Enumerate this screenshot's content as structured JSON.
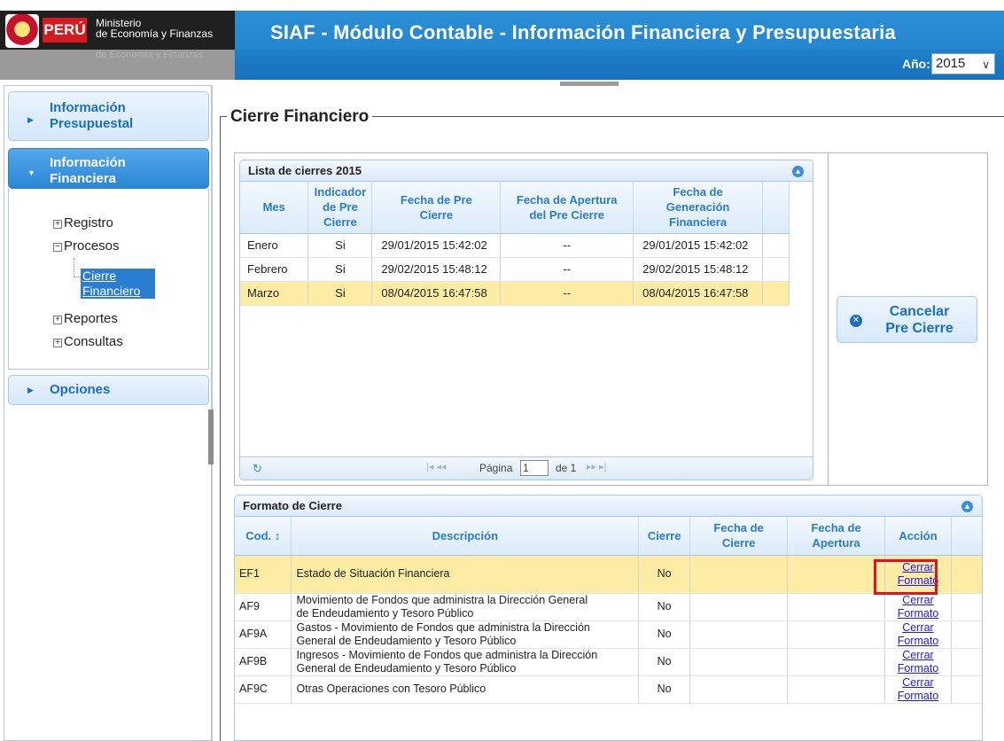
{
  "header": {
    "logo_country": "PERÚ",
    "logo_line1": "Ministerio",
    "logo_line2": "de Economía y Finanzas",
    "logo_reflection": "de Economía y Finanzas",
    "title": "SIAF - Módulo Contable - Información Financiera y Presupuestaria",
    "year_label": "Año:",
    "year_value": "2015"
  },
  "sidebar": {
    "sections": [
      {
        "label_line1": "Información",
        "label_line2": "Presupuestal"
      },
      {
        "label_line1": "Información",
        "label_line2": "Financiera"
      },
      {
        "label_line1": "Opciones",
        "label_line2": ""
      }
    ],
    "tree": {
      "registro": "Registro",
      "procesos": "Procesos",
      "cierre_line1": "Cierre",
      "cierre_line2": "Financiero",
      "reportes": "Reportes",
      "consultas": "Consultas",
      "expanded_symbol": "−",
      "collapsed_symbol": "+"
    }
  },
  "main": {
    "title": "Cierre Financiero",
    "lista": {
      "title": "Lista de cierres 2015",
      "columns": [
        [
          "Mes"
        ],
        [
          "Indicador",
          "de Pre",
          "Cierre"
        ],
        [
          "Fecha de Pre",
          "Cierre"
        ],
        [
          "Fecha de Apertura",
          "del Pre Cierre"
        ],
        [
          "Fecha de",
          "Generación",
          "Financiera"
        ]
      ],
      "rows": [
        {
          "mes": "Enero",
          "indicador": "Si",
          "fecha_pre": "29/01/2015 15:42:02",
          "fecha_apertura": "--",
          "fecha_gen": "29/01/2015 15:42:02"
        },
        {
          "mes": "Febrero",
          "indicador": "Si",
          "fecha_pre": "29/02/2015 15:48:12",
          "fecha_apertura": "--",
          "fecha_gen": "29/02/2015 15:48:12"
        },
        {
          "mes": "Marzo",
          "indicador": "Si",
          "fecha_pre": "08/04/2015 16:47:58",
          "fecha_apertura": "--",
          "fecha_gen": "08/04/2015 16:47:58"
        }
      ],
      "pager": {
        "page_label": "Página",
        "page_value": "1",
        "of_label": "de 1",
        "first_prev": "|◂ ◂◂",
        "next_last": "▸▸ ▸|",
        "refresh": "↻"
      }
    },
    "cancel_button": {
      "line1": "Cancelar",
      "line2": "Pre Cierre"
    },
    "formato": {
      "title": "Formato de Cierre",
      "columns": [
        [
          "Cod. ↕"
        ],
        [
          "Descripción"
        ],
        [
          "Cierre"
        ],
        [
          "Fecha de",
          "Cierre"
        ],
        [
          "Fecha de",
          "Apertura"
        ],
        [
          "Acción"
        ]
      ],
      "rows": [
        {
          "cod": "EF1",
          "desc1": "Estado de Situación Financiera",
          "desc2": "",
          "cierre": "No",
          "fecha_cierre": "",
          "fecha_apertura": "",
          "accion1": "Cerrar",
          "accion2": "Formato"
        },
        {
          "cod": "AF9",
          "desc1": "Movimiento de Fondos que administra la Dirección General",
          "desc2": "de Endeudamiento y Tesoro Público",
          "cierre": "No",
          "fecha_cierre": "",
          "fecha_apertura": "",
          "accion1": "Cerrar",
          "accion2": "Formato"
        },
        {
          "cod": "AF9A",
          "desc1": "Gastos - Movimiento de Fondos que administra la Dirección",
          "desc2": "General de Endeudamiento y Tesoro Público",
          "cierre": "No",
          "fecha_cierre": "",
          "fecha_apertura": "",
          "accion1": "Cerrar",
          "accion2": "Formato"
        },
        {
          "cod": "AF9B",
          "desc1": "Ingresos - Movimiento de Fondos que administra la Dirección",
          "desc2": "General de Endeudamiento y Tesoro Público",
          "cierre": "No",
          "fecha_cierre": "",
          "fecha_apertura": "",
          "accion1": "Cerrar",
          "accion2": "Formato"
        },
        {
          "cod": "AF9C",
          "desc1": "Otras Operaciones con Tesoro Público",
          "desc2": "",
          "cierre": "No",
          "fecha_cierre": "",
          "fecha_apertura": "",
          "accion1": "Cerrar",
          "accion2": "Formato"
        }
      ]
    }
  },
  "colors": {
    "header_blue": "#1d7ec8",
    "accordion_active": "#2a86d4",
    "selected_row": "#fdeca3",
    "link_blue": "#1a1aff",
    "highlight_red": "#e0141e"
  },
  "icons": {
    "logo": "peru-shield-icon",
    "collapse": "chevron-up-circle-icon",
    "cancel": "close-circle-icon",
    "refresh": "refresh-icon",
    "accordion_arrow": "triangle-right-icon",
    "year_dropdown": "chevron-down-icon"
  }
}
